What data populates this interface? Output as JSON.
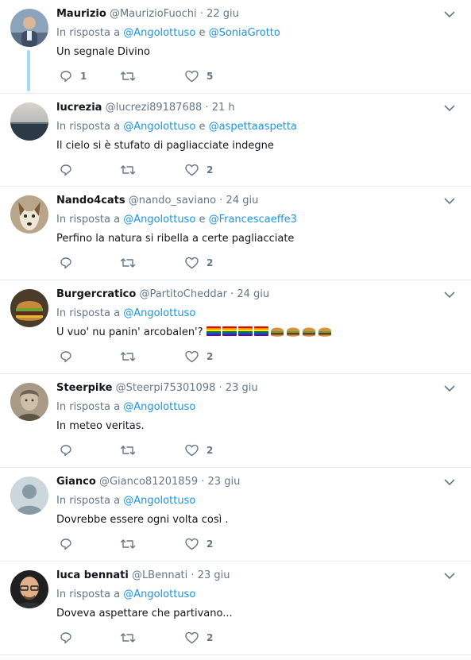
{
  "tweets": [
    {
      "name": "Maurizio",
      "handle": "@MaurizioFuochi",
      "time": "22 giu",
      "reply_prefix": "In risposta a",
      "reply_to": [
        "@Angolottuso",
        "@SoniaGrotto"
      ],
      "reply_joiner": "e",
      "text": "Un segnale Divino",
      "replies": "1",
      "retweets": "",
      "likes": "5",
      "avatar_icon": "man-avatar-icon"
    },
    {
      "name": "lucrezia",
      "handle": "@lucrezi89187688",
      "time": "21 h",
      "reply_prefix": "In risposta a",
      "reply_to": [
        "@Angolottuso",
        "@aspettaaspetta"
      ],
      "reply_joiner": "e",
      "text": "Il cielo si è stufato di pagliacciate indegne",
      "replies": "",
      "retweets": "",
      "likes": "2",
      "avatar_icon": "sea-landscape-avatar-icon"
    },
    {
      "name": "Nando4cats",
      "handle": "@nando_saviano",
      "time": "24 giu",
      "reply_prefix": "In risposta a",
      "reply_to": [
        "@Angolottuso",
        "@Francescaeffe3"
      ],
      "reply_joiner": "e",
      "text": "Perfino la natura si ribella a certe pagliacciate",
      "replies": "",
      "retweets": "",
      "likes": "2",
      "avatar_icon": "dog-avatar-icon"
    },
    {
      "name": "Burgercratico",
      "handle": "@PartitoCheddar",
      "time": "24 giu",
      "reply_prefix": "In risposta a",
      "reply_to": [
        "@Angolottuso"
      ],
      "reply_joiner": "",
      "text": "U vuo' nu panin' arcobalen'?",
      "text_emoji": [
        "rainbow-flag-emoji",
        "rainbow-flag-emoji",
        "rainbow-flag-emoji",
        "rainbow-flag-emoji",
        "hamburger-emoji",
        "hamburger-emoji",
        "hamburger-emoji",
        "hamburger-emoji"
      ],
      "replies": "",
      "retweets": "",
      "likes": "2",
      "avatar_icon": "burger-avatar-icon"
    },
    {
      "name": "Steerpike",
      "handle": "@Steerpi75301098",
      "time": "23 giu",
      "reply_prefix": "In risposta a",
      "reply_to": [
        "@Angolottuso"
      ],
      "reply_joiner": "",
      "text": "In meteo veritas.",
      "replies": "",
      "retweets": "",
      "likes": "2",
      "avatar_icon": "sepia-portrait-avatar-icon"
    },
    {
      "name": "Gianco",
      "handle": "@Gianco81201859",
      "time": "23 giu",
      "reply_prefix": "In risposta a",
      "reply_to": [
        "@Angolottuso"
      ],
      "reply_joiner": "",
      "text": "Dovrebbe essere ogni volta così .",
      "replies": "",
      "retweets": "",
      "likes": "2",
      "avatar_icon": "default-avatar-icon"
    },
    {
      "name": "luca bennati",
      "handle": "@LBennati",
      "time": "23 giu",
      "reply_prefix": "In risposta a",
      "reply_to": [
        "@Angolottuso"
      ],
      "reply_joiner": "",
      "text": "Doveva aspettare che partivano...",
      "replies": "",
      "retweets": "",
      "likes": "2",
      "avatar_icon": "bald-man-glasses-avatar-icon"
    }
  ],
  "colors": {
    "link": "#1b95e0",
    "secondary_text": "#657786",
    "thread_line": "#a4d9f9",
    "divider": "#e6ecf0"
  }
}
